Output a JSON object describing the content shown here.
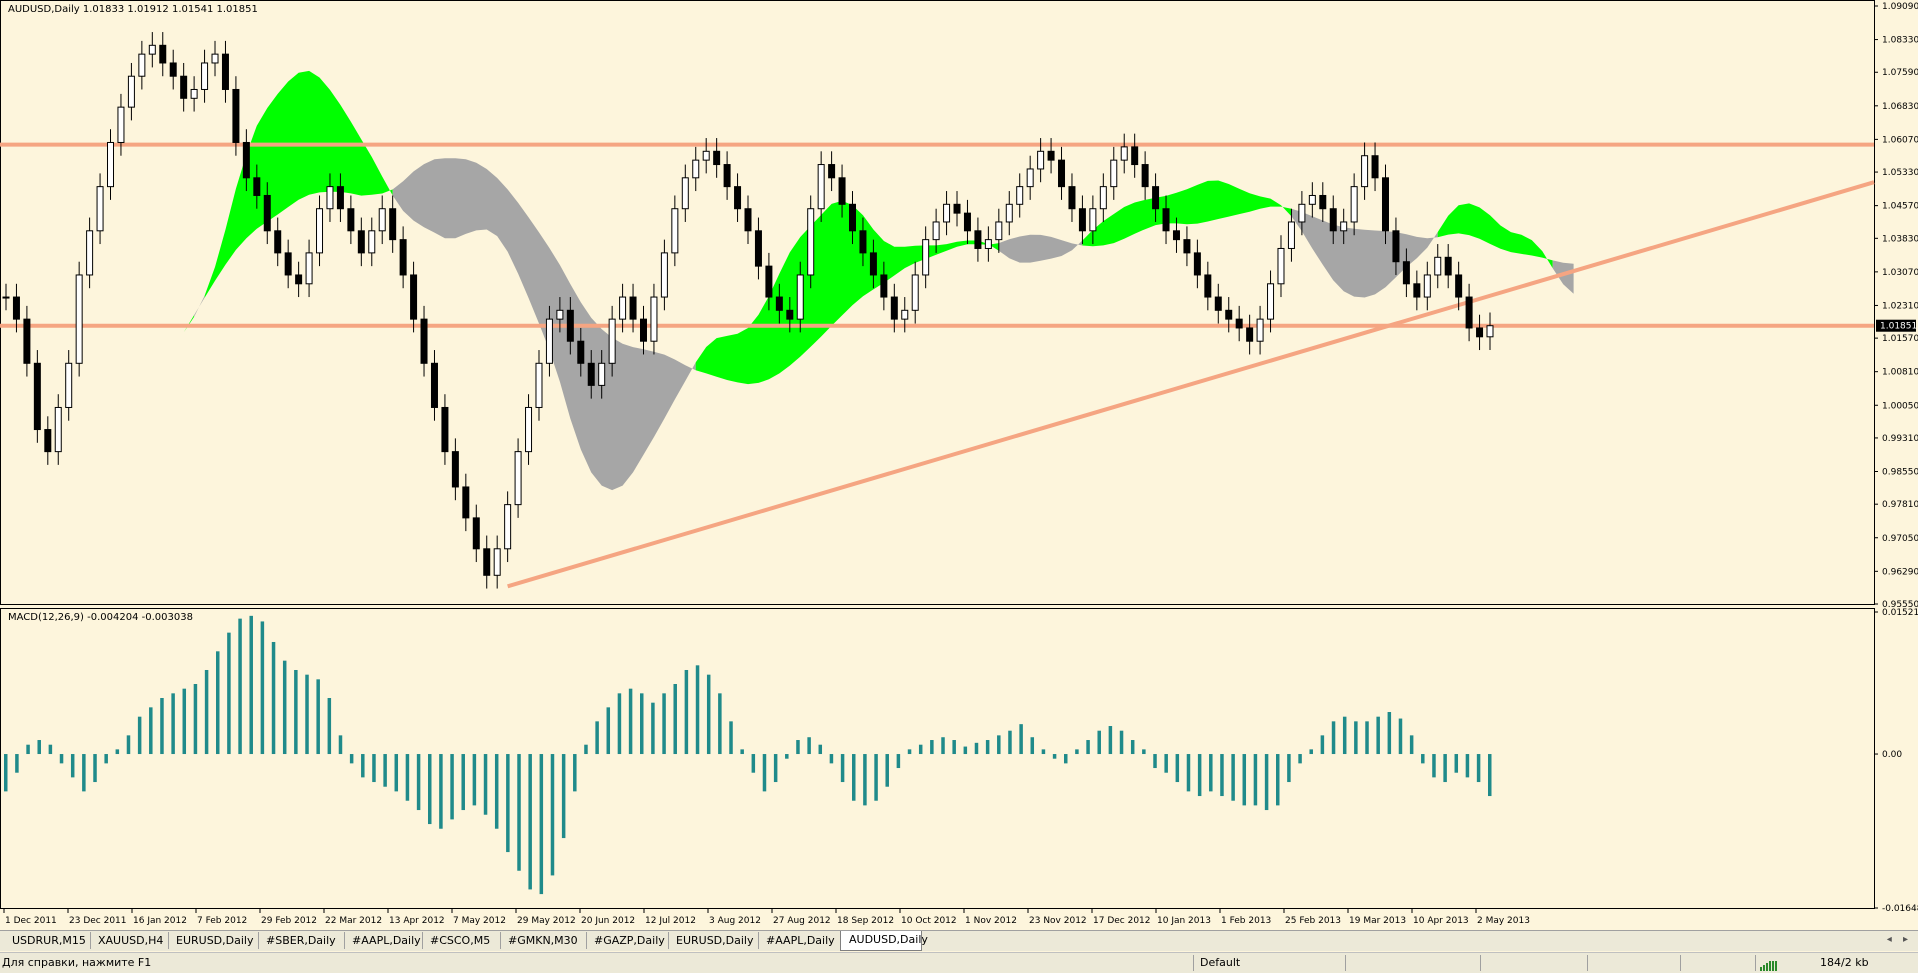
{
  "window": {
    "main_info": "AUDUSD,Daily  1.01833 1.01912 1.01541 1.01851",
    "macd_info": "MACD(12,26,9) -0.004204 -0.003038"
  },
  "colors": {
    "background": "#fdf5dc",
    "bull_cloud": "#00ff00",
    "bear_cloud": "#a6a6a6",
    "trendline": "#f5a582",
    "macd_hist": "#1f8a8a",
    "candles": "#000000"
  },
  "tabs": [
    "USDRUR,M15",
    "XAUUSD,H4",
    "EURUSD,Daily",
    "#SBER,Daily",
    "#AAPL,Daily",
    "#CSCO,M5",
    "#GMKN,M30",
    "#GAZP,Daily",
    "EURUSD,Daily",
    "#AAPL,Daily",
    "AUDUSD,Daily"
  ],
  "active_tab": "AUDUSD,Daily",
  "status": {
    "help": "Для справки, нажмите F1",
    "profile": "Default",
    "traffic": "184/2 kb"
  },
  "chart_data": [
    {
      "type": "candlestick",
      "symbol": "AUDUSD",
      "timeframe": "Daily",
      "ohlc_last": {
        "open": 1.01833,
        "high": 1.01912,
        "low": 1.01541,
        "close": 1.01851
      },
      "current_price_label": "1.01851",
      "yticks": [
        "1.09090",
        "1.08330",
        "1.07590",
        "1.06830",
        "1.06070",
        "1.05330",
        "1.04570",
        "1.03830",
        "1.03070",
        "1.02310",
        "1.01570",
        "1.00810",
        "1.00050",
        "0.99310",
        "0.98550",
        "0.97810",
        "0.97050",
        "0.96290",
        "0.95550"
      ],
      "ylim": [
        0.9555,
        1.0909
      ],
      "xticks": [
        "1 Dec 2011",
        "23 Dec 2011",
        "16 Jan 2012",
        "7 Feb 2012",
        "29 Feb 2012",
        "22 Mar 2012",
        "13 Apr 2012",
        "7 May 2012",
        "29 May 2012",
        "20 Jun 2012",
        "12 Jul 2012",
        "3 Aug 2012",
        "27 Aug 2012",
        "18 Sep 2012",
        "10 Oct 2012",
        "1 Nov 2012",
        "23 Nov 2012",
        "17 Dec 2012",
        "10 Jan 2013",
        "1 Feb 2013",
        "25 Feb 2013",
        "19 Mar 2013",
        "10 Apr 2013",
        "2 May 2013"
      ],
      "horizontal_lines": [
        1.0595,
        1.0185
      ],
      "trendline": {
        "from": {
          "date": "29 May 2012",
          "price": 0.9595
        },
        "to": {
          "date": "end",
          "price": 1.051
        }
      },
      "close_path": [
        1.025,
        1.02,
        1.01,
        0.995,
        0.99,
        1.0,
        1.01,
        1.03,
        1.04,
        1.05,
        1.06,
        1.068,
        1.075,
        1.08,
        1.082,
        1.078,
        1.075,
        1.07,
        1.072,
        1.078,
        1.08,
        1.072,
        1.06,
        1.052,
        1.048,
        1.04,
        1.035,
        1.03,
        1.028,
        1.035,
        1.045,
        1.05,
        1.045,
        1.04,
        1.035,
        1.04,
        1.045,
        1.038,
        1.03,
        1.02,
        1.01,
        1.0,
        0.99,
        0.982,
        0.975,
        0.968,
        0.962,
        0.968,
        0.978,
        0.99,
        1.0,
        1.01,
        1.02,
        1.022,
        1.015,
        1.01,
        1.005,
        1.01,
        1.02,
        1.025,
        1.02,
        1.015,
        1.025,
        1.035,
        1.045,
        1.052,
        1.056,
        1.058,
        1.055,
        1.05,
        1.045,
        1.04,
        1.032,
        1.025,
        1.022,
        1.02,
        1.03,
        1.045,
        1.055,
        1.052,
        1.046,
        1.04,
        1.035,
        1.03,
        1.025,
        1.02,
        1.022,
        1.03,
        1.038,
        1.042,
        1.046,
        1.044,
        1.04,
        1.036,
        1.038,
        1.042,
        1.046,
        1.05,
        1.054,
        1.058,
        1.056,
        1.05,
        1.045,
        1.04,
        1.045,
        1.05,
        1.056,
        1.059,
        1.055,
        1.05,
        1.045,
        1.04,
        1.038,
        1.035,
        1.03,
        1.025,
        1.022,
        1.02,
        1.018,
        1.015,
        1.02,
        1.028,
        1.036,
        1.042,
        1.046,
        1.048,
        1.045,
        1.04,
        1.042,
        1.05,
        1.057,
        1.052,
        1.04,
        1.033,
        1.028,
        1.025,
        1.03,
        1.034,
        1.03,
        1.025,
        1.018,
        1.016,
        1.02
      ]
    },
    {
      "type": "bar",
      "name": "MACD(12,26,9)",
      "values_last": {
        "macd": -0.004204,
        "signal": -0.003038
      },
      "yticks": [
        "0.015211",
        "0.00",
        "-0.016489"
      ],
      "ylim": [
        -0.016489,
        0.015211
      ],
      "histogram": [
        -0.004,
        -0.002,
        0.001,
        0.0015,
        0.001,
        -0.001,
        -0.0025,
        -0.004,
        -0.003,
        -0.001,
        0.0005,
        0.002,
        0.004,
        0.005,
        0.006,
        0.0065,
        0.007,
        0.0075,
        0.009,
        0.011,
        0.013,
        0.0145,
        0.0148,
        0.0142,
        0.012,
        0.01,
        0.009,
        0.0085,
        0.008,
        0.006,
        0.002,
        -0.001,
        -0.0025,
        -0.003,
        -0.0035,
        -0.004,
        -0.005,
        -0.006,
        -0.0075,
        -0.008,
        -0.007,
        -0.006,
        -0.0055,
        -0.0065,
        -0.008,
        -0.0105,
        -0.0125,
        -0.0145,
        -0.015,
        -0.013,
        -0.009,
        -0.004,
        0.001,
        0.0035,
        0.005,
        0.0065,
        0.007,
        0.0065,
        0.0055,
        0.0065,
        0.0075,
        0.009,
        0.0095,
        0.0085,
        0.0065,
        0.0035,
        0.0005,
        -0.002,
        -0.004,
        -0.003,
        -0.0005,
        0.0015,
        0.0018,
        0.001,
        -0.001,
        -0.003,
        -0.005,
        -0.0055,
        -0.005,
        -0.0035,
        -0.0015,
        0.0005,
        0.001,
        0.0015,
        0.0018,
        0.0015,
        0.0008,
        0.0012,
        0.0015,
        0.002,
        0.0025,
        0.0032,
        0.0018,
        0.0005,
        -0.0005,
        -0.001,
        0.0005,
        0.0015,
        0.0025,
        0.003,
        0.0025,
        0.0015,
        0.0005,
        -0.0015,
        -0.002,
        -0.003,
        -0.004,
        -0.0045,
        -0.004,
        -0.0045,
        -0.005,
        -0.0055,
        -0.0055,
        -0.006,
        -0.0055,
        -0.003,
        -0.001,
        0.0005,
        0.002,
        0.0035,
        0.004,
        0.0035,
        0.0035,
        0.004,
        0.0045,
        0.0038,
        0.002,
        -0.001,
        -0.0025,
        -0.003,
        -0.002,
        -0.0025,
        -0.003,
        -0.0045
      ]
    }
  ]
}
